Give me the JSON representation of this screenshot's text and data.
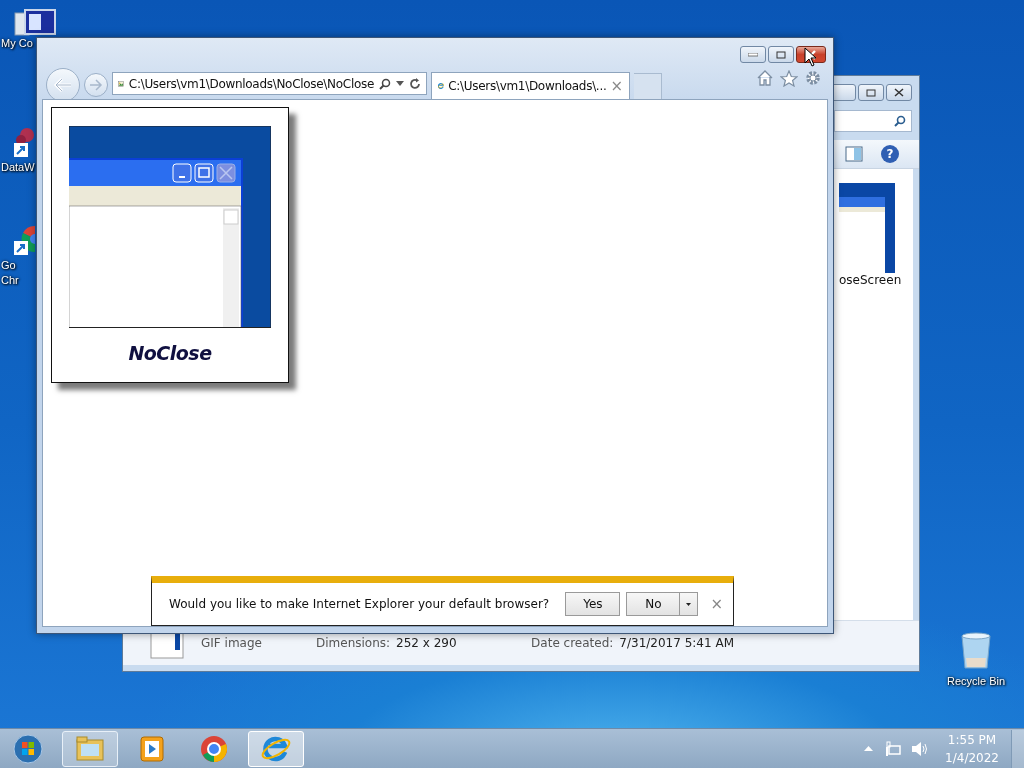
{
  "desktop_icons": [
    {
      "kind": "computer",
      "label_lines": [
        "My Co"
      ]
    },
    {
      "kind": "shortcut",
      "label_lines": [
        "DataW"
      ]
    },
    {
      "kind": "chrome",
      "label_lines": [
        "Go",
        "Chr"
      ]
    },
    {
      "kind": "recycle",
      "label_lines": [
        "Recycle Bin"
      ]
    }
  ],
  "explorer_window": {
    "help": "?",
    "file_label": "oseScreen",
    "details": {
      "type": "GIF image",
      "dimensions_label": "Dimensions:",
      "dimensions": "252 x 290",
      "date_label": "Date created:",
      "date": "7/31/2017 5:41 AM"
    }
  },
  "browser_window": {
    "address": "C:\\Users\\vm1\\Downloads\\NoClose\\NoClose",
    "tabs": [
      {
        "title": "C:\\Users\\vm1\\Downloads\\...",
        "close": "×",
        "selected": true
      }
    ],
    "image_caption": "NoClose",
    "notification": {
      "message": "Would you like to make Internet Explorer your default browser?",
      "yes": "Yes",
      "no": "No",
      "close": "×"
    }
  },
  "taskbar": {
    "items": [
      {
        "kind": "explorer",
        "selected": false
      },
      {
        "kind": "media",
        "selected": false
      },
      {
        "kind": "chrome",
        "selected": false
      },
      {
        "kind": "ie",
        "selected": true
      }
    ],
    "clock": {
      "time": "1:55 PM",
      "date": "1/4/2022"
    }
  }
}
